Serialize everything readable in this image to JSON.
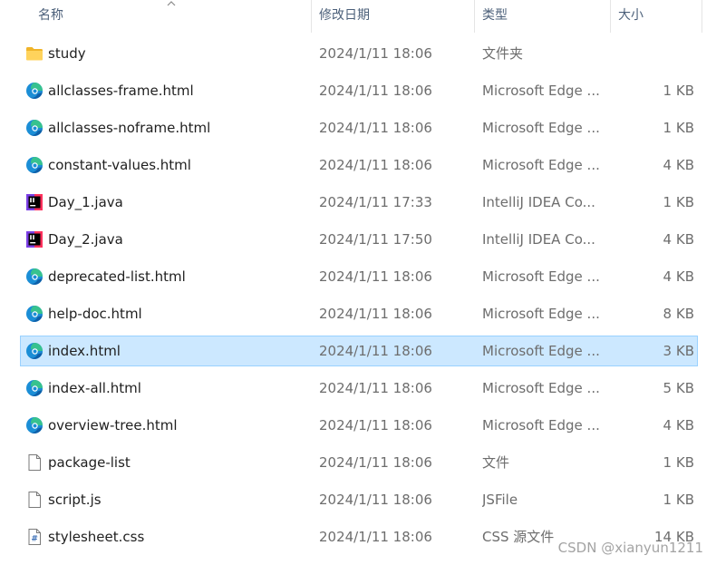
{
  "header": {
    "name": "名称",
    "date": "修改日期",
    "type": "类型",
    "size": "大小"
  },
  "files": [
    {
      "name": "study",
      "date": "2024/1/11 18:06",
      "type": "文件夹",
      "size": "",
      "icon": "folder-icon"
    },
    {
      "name": "allclasses-frame.html",
      "date": "2024/1/11 18:06",
      "type": "Microsoft Edge ...",
      "size": "1 KB",
      "icon": "edge-icon"
    },
    {
      "name": "allclasses-noframe.html",
      "date": "2024/1/11 18:06",
      "type": "Microsoft Edge ...",
      "size": "1 KB",
      "icon": "edge-icon"
    },
    {
      "name": "constant-values.html",
      "date": "2024/1/11 18:06",
      "type": "Microsoft Edge ...",
      "size": "4 KB",
      "icon": "edge-icon"
    },
    {
      "name": "Day_1.java",
      "date": "2024/1/11 17:33",
      "type": "IntelliJ IDEA Co...",
      "size": "1 KB",
      "icon": "intellij-icon"
    },
    {
      "name": "Day_2.java",
      "date": "2024/1/11 17:50",
      "type": "IntelliJ IDEA Co...",
      "size": "4 KB",
      "icon": "intellij-icon"
    },
    {
      "name": "deprecated-list.html",
      "date": "2024/1/11 18:06",
      "type": "Microsoft Edge ...",
      "size": "4 KB",
      "icon": "edge-icon"
    },
    {
      "name": "help-doc.html",
      "date": "2024/1/11 18:06",
      "type": "Microsoft Edge ...",
      "size": "8 KB",
      "icon": "edge-icon"
    },
    {
      "name": "index.html",
      "date": "2024/1/11 18:06",
      "type": "Microsoft Edge ...",
      "size": "3 KB",
      "icon": "edge-icon",
      "selected": true
    },
    {
      "name": "index-all.html",
      "date": "2024/1/11 18:06",
      "type": "Microsoft Edge ...",
      "size": "5 KB",
      "icon": "edge-icon"
    },
    {
      "name": "overview-tree.html",
      "date": "2024/1/11 18:06",
      "type": "Microsoft Edge ...",
      "size": "4 KB",
      "icon": "edge-icon"
    },
    {
      "name": "package-list",
      "date": "2024/1/11 18:06",
      "type": "文件",
      "size": "1 KB",
      "icon": "blank-file-icon"
    },
    {
      "name": "script.js",
      "date": "2024/1/11 18:06",
      "type": "JSFile",
      "size": "1 KB",
      "icon": "blank-file-icon"
    },
    {
      "name": "stylesheet.css",
      "date": "2024/1/11 18:06",
      "type": "CSS 源文件",
      "size": "14 KB",
      "icon": "css-file-icon"
    }
  ],
  "watermark": "CSDN @xianyun1211",
  "colors": {
    "selected_bg": "#cce8ff",
    "selected_border": "#99d1ff",
    "header_text": "#4c607a",
    "secondary_text": "#6d6d6d"
  }
}
